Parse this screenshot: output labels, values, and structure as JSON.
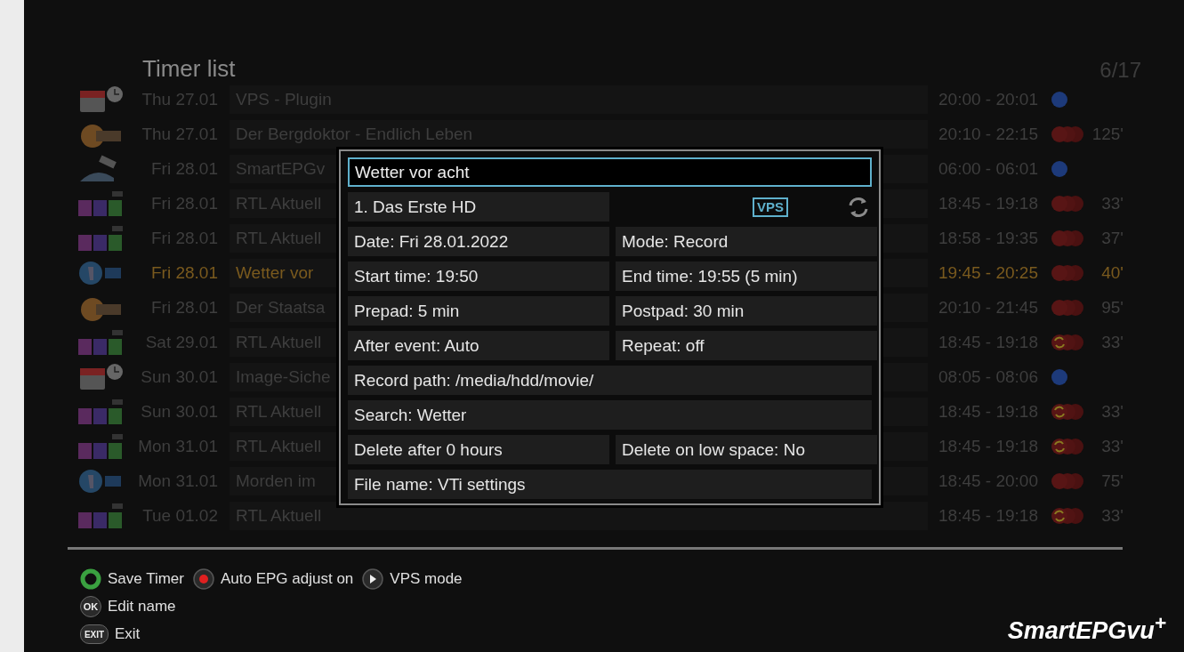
{
  "header": {
    "title": "Timer list",
    "counter": "6/17"
  },
  "timers": [
    {
      "logo": {
        "kind": "calendar"
      },
      "date": "Thu 27.01",
      "title": "VPS - Plugin",
      "time": "20:00 - 20:01",
      "status": {
        "kind": "plugin"
      },
      "selected": false
    },
    {
      "logo": {
        "kind": "zdf"
      },
      "date": "Thu 27.01",
      "title": "Der Bergdoktor - Endlich Leben",
      "time": "20:10 - 22:15",
      "status": {
        "kind": "record"
      },
      "duration": "125'",
      "selected": false
    },
    {
      "logo": {
        "kind": "satellite"
      },
      "date": "Fri 28.01",
      "title": "SmartEPGv",
      "time": "06:00 - 06:01",
      "status": {
        "kind": "plugin"
      },
      "selected": false
    },
    {
      "logo": {
        "kind": "rtl"
      },
      "date": "Fri 28.01",
      "title": "RTL Aktuell",
      "time": "18:45 - 19:18",
      "status": {
        "kind": "record"
      },
      "duration": "33'",
      "selected": false
    },
    {
      "logo": {
        "kind": "rtl"
      },
      "date": "Fri 28.01",
      "title": "RTL Aktuell",
      "time": "18:58 - 19:35",
      "status": {
        "kind": "record"
      },
      "duration": "37'",
      "selected": false
    },
    {
      "logo": {
        "kind": "ard"
      },
      "date": "Fri 28.01",
      "title": "Wetter vor",
      "time": "19:45 - 20:25",
      "status": {
        "kind": "record"
      },
      "duration": "40'",
      "selected": true
    },
    {
      "logo": {
        "kind": "zdf"
      },
      "date": "Fri 28.01",
      "title": "Der Staatsa",
      "time": "20:10 - 21:45",
      "status": {
        "kind": "record"
      },
      "duration": "95'",
      "selected": false
    },
    {
      "logo": {
        "kind": "rtl"
      },
      "date": "Sat 29.01",
      "title": "RTL Aktuell",
      "time": "18:45 - 19:18",
      "status": {
        "kind": "repeat"
      },
      "duration": "33'",
      "selected": false
    },
    {
      "logo": {
        "kind": "calendar"
      },
      "date": "Sun 30.01",
      "title": "Image-Siche",
      "time": "08:05 - 08:06",
      "status": {
        "kind": "plugin"
      },
      "selected": false
    },
    {
      "logo": {
        "kind": "rtl"
      },
      "date": "Sun 30.01",
      "title": "RTL Aktuell",
      "time": "18:45 - 19:18",
      "status": {
        "kind": "repeat"
      },
      "duration": "33'",
      "selected": false
    },
    {
      "logo": {
        "kind": "rtl"
      },
      "date": "Mon 31.01",
      "title": "RTL Aktuell",
      "time": "18:45 - 19:18",
      "status": {
        "kind": "repeat"
      },
      "duration": "33'",
      "selected": false
    },
    {
      "logo": {
        "kind": "ard"
      },
      "date": "Mon 31.01",
      "title": "Morden im",
      "time": "18:45 - 20:00",
      "status": {
        "kind": "record"
      },
      "duration": "75'",
      "selected": false
    },
    {
      "logo": {
        "kind": "rtl"
      },
      "date": "Tue 01.02",
      "title": "RTL Aktuell",
      "time": "18:45 - 19:18",
      "status": {
        "kind": "repeat"
      },
      "duration": "33'",
      "selected": false
    }
  ],
  "editor": {
    "name": "Wetter vor acht",
    "badge": "VPS",
    "rows": [
      {
        "kind": "channel",
        "cells": [
          "1. Das Erste HD"
        ]
      },
      {
        "kind": "pair",
        "cells": [
          "Date: Fri 28.01.2022",
          "Mode: Record"
        ]
      },
      {
        "kind": "pair",
        "cells": [
          "Start time: 19:50",
          "End time: 19:55 (5 min)"
        ]
      },
      {
        "kind": "pair",
        "cells": [
          "Prepad: 5 min",
          "Postpad: 30 min"
        ]
      },
      {
        "kind": "pair",
        "cells": [
          "After event: Auto",
          "Repeat: off"
        ]
      },
      {
        "kind": "full",
        "cells": [
          "Record path: /media/hdd/movie/"
        ]
      },
      {
        "kind": "full",
        "cells": [
          "Search: Wetter"
        ]
      },
      {
        "kind": "pair",
        "cells": [
          "Delete after 0 hours",
          "Delete on low space: No"
        ]
      },
      {
        "kind": "full",
        "cells": [
          "File name: VTi settings"
        ]
      }
    ]
  },
  "hints": [
    [
      {
        "kind": "ring",
        "label": "Save Timer"
      },
      {
        "kind": "dot",
        "label": "Auto EPG adjust on"
      },
      {
        "kind": "play",
        "label": "VPS mode"
      }
    ],
    [
      {
        "kind": "round",
        "key_text": "OK",
        "label": "Edit name"
      }
    ],
    [
      {
        "kind": "pill",
        "key_text": "EXIT",
        "label": "Exit"
      }
    ]
  ],
  "brand": "SmartEPGvu$^{+}$"
}
